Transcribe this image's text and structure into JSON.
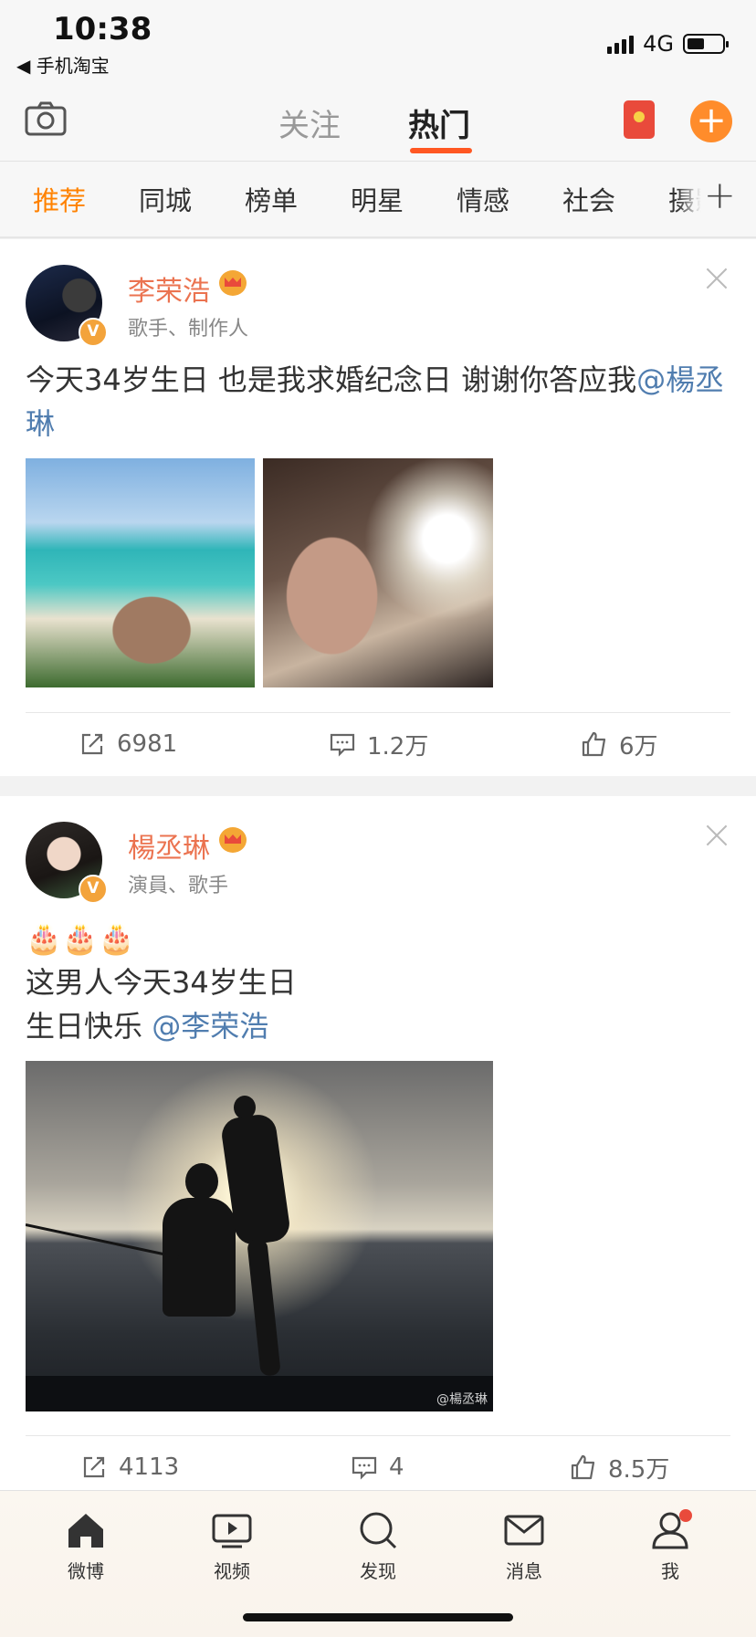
{
  "status_bar": {
    "time": "10:38",
    "back_app": "◀ 手机淘宝",
    "network": "4G"
  },
  "top_nav": {
    "tabs": [
      {
        "label": "关注"
      },
      {
        "label": "热门"
      }
    ],
    "add_symbol": "+"
  },
  "category_bar": {
    "items": [
      "推荐",
      "同城",
      "榜单",
      "明星",
      "情感",
      "社会",
      "摄影"
    ],
    "active_index": 0,
    "more_symbol": "+"
  },
  "posts": [
    {
      "author": "李荣浩",
      "verified_badge": "V",
      "description": "歌手、制作人",
      "text": "今天34岁生日 也是我求婚纪念日 谢谢你答应我",
      "mention": "@楊丞琳",
      "stats": {
        "reposts": "6981",
        "comments": "1.2万",
        "likes": "6万"
      }
    },
    {
      "author": "楊丞琳",
      "verified_badge": "V",
      "description": "演員、歌手",
      "text_line1": "🎂🎂🎂",
      "text_line2": "这男人今天34岁生日",
      "text_line3": "生日快乐 ",
      "mention": "@李荣浩",
      "image_watermark": "@楊丞琳",
      "stats": {
        "reposts": "4113",
        "comments": "4",
        "likes": "8.5万"
      }
    }
  ],
  "bottom_tabs": [
    {
      "label": "微博",
      "icon": "home-icon"
    },
    {
      "label": "视频",
      "icon": "video-icon"
    },
    {
      "label": "发现",
      "icon": "search-icon"
    },
    {
      "label": "消息",
      "icon": "mail-icon"
    },
    {
      "label": "我",
      "icon": "profile-icon"
    }
  ],
  "colors": {
    "accent": "#ff8200",
    "username": "#eb7350",
    "mention": "#507daf",
    "hot_underline": "#ff5722"
  }
}
